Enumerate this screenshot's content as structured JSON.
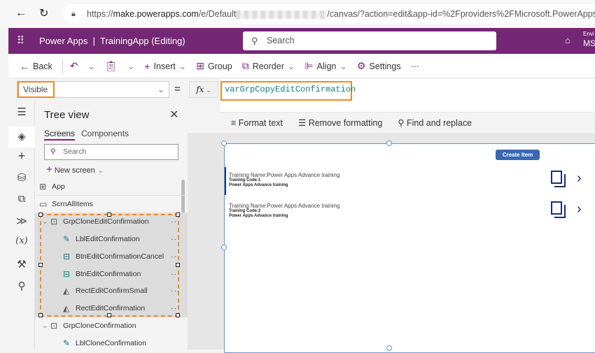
{
  "browser": {
    "url_prefix": "https://",
    "url_domain": "make.powerapps.com",
    "url_path": "/e/Default",
    "url_suffix": "/canvas/?action=edit&app-id=%2Fproviders%2FMicrosoft.PowerApps"
  },
  "header": {
    "product": "Power Apps",
    "separator": "|",
    "app_title": "TrainingApp (Editing)",
    "search_placeholder": "Search",
    "env_label": "Envi",
    "env_value": "MSI"
  },
  "toolbar": {
    "back": "Back",
    "insert": "Insert",
    "group": "Group",
    "reorder": "Reorder",
    "align": "Align",
    "settings": "Settings",
    "more": "···"
  },
  "formula": {
    "property": "Visible",
    "equals": "=",
    "fx": "fx",
    "value": "varGrpCopyEditConfirmation"
  },
  "format_bar": {
    "format_text": "Format text",
    "remove_formatting": "Remove formatting",
    "find_replace": "Find and replace"
  },
  "tree": {
    "title": "Tree view",
    "tabs": [
      "Screens",
      "Components"
    ],
    "search_placeholder": "Search",
    "new_screen": "New screen",
    "items": [
      {
        "label": "App",
        "type": "app",
        "indent": 0
      },
      {
        "label": "ScrnAllItems",
        "type": "screen",
        "indent": 0
      },
      {
        "label": "GrpCloneEditConfirmation",
        "type": "group",
        "indent": 1,
        "selected": true
      },
      {
        "label": "LblEditConfirmation",
        "type": "label",
        "indent": 2,
        "selected": true
      },
      {
        "label": "BtnEditConfirmationCancel",
        "type": "button",
        "indent": 2,
        "selected": true
      },
      {
        "label": "BtnEditConfirmation",
        "type": "button",
        "indent": 2,
        "selected": true
      },
      {
        "label": "RectEditConfirmSmall",
        "type": "shape",
        "indent": 2,
        "selected": true
      },
      {
        "label": "RectEditConfirmation",
        "type": "shape",
        "indent": 2,
        "selected": true
      },
      {
        "label": "GrpCloneConfirmation",
        "type": "group",
        "indent": 1
      },
      {
        "label": "LblCloneConfirmation",
        "type": "label",
        "indent": 2
      }
    ]
  },
  "canvas": {
    "create_button": "Create Item",
    "items": [
      {
        "name": "Training Name:Power Apps Advance training",
        "code": "Training Code:1",
        "desc": "Power Apps Advance training"
      },
      {
        "name": "Training Name:Power Apps Advance training",
        "code": "Training Code:2",
        "desc": "Power Apps Advance training"
      }
    ]
  },
  "colors": {
    "brand": "#742774",
    "highlight": "#f08a24",
    "formula_text": "#0e7c86",
    "button": "#3867b4"
  }
}
